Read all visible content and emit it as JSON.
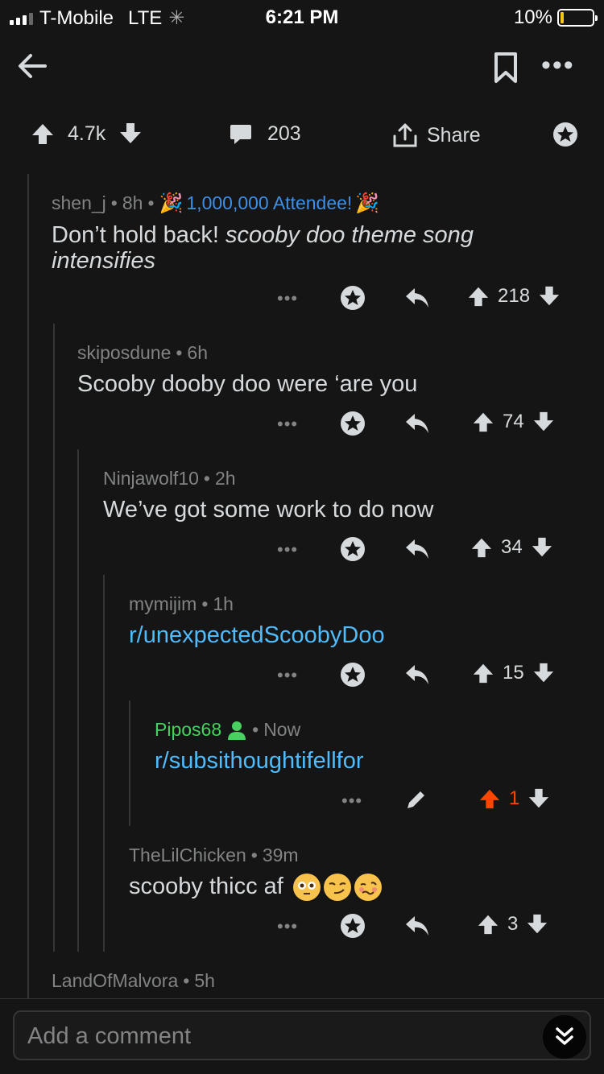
{
  "status_bar": {
    "carrier": "T-Mobile",
    "network": "LTE",
    "time": "6:21 PM",
    "battery": "10%"
  },
  "post_bar": {
    "score": "4.7k",
    "comments": "203",
    "share_label": "Share"
  },
  "comments": [
    {
      "author": "shen_j",
      "age": "8h",
      "flair": "1,000,000 Attendee!",
      "body_plain": "Don’t hold back! ",
      "body_italic_1": "scooby doo theme song",
      "body_italic_2": "intensifies",
      "score": "218"
    },
    {
      "author": "skiposdune",
      "age": "6h",
      "body": "Scooby dooby doo were ‘are you",
      "score": "74"
    },
    {
      "author": "Ninjawolf10",
      "age": "2h",
      "body": "We’ve got some work to do now",
      "score": "34"
    },
    {
      "author": "mymijim",
      "age": "1h",
      "body": "r/unexpectedScoobyDoo",
      "score": "15"
    },
    {
      "author": "Pipos68",
      "age": "Now",
      "body": "r/subsithoughtifellfor",
      "score": "1"
    },
    {
      "author": "TheLilChicken",
      "age": "39m",
      "body": "scooby thicc af",
      "score": "3"
    },
    {
      "author": "LandOfMalvora",
      "age": "5h"
    }
  ],
  "composer": {
    "placeholder": "Add a comment"
  },
  "colors": {
    "background": "#151515",
    "link": "#4fbcff",
    "upvote_active": "#ff4500",
    "op_user": "#46d160",
    "flair": "#3d8ee6"
  }
}
